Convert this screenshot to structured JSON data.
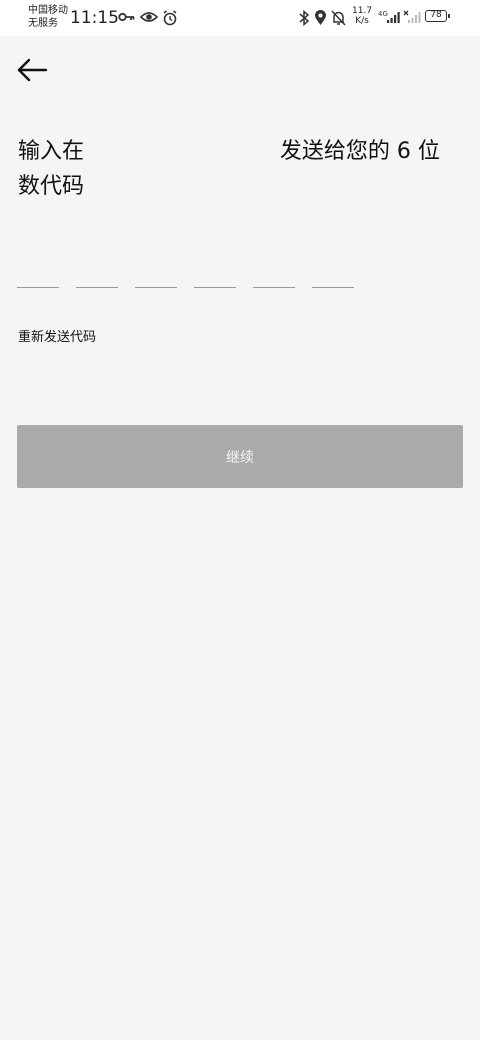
{
  "status_bar": {
    "carrier_line1": "中国移动",
    "carrier_line2": "无服务",
    "time": "11:15",
    "net_speed_value": "11.7",
    "net_speed_unit": "K/s",
    "network": "4G",
    "battery_level": "78",
    "icons": [
      "key-icon",
      "eye-icon",
      "alarm-icon",
      "bluetooth-icon",
      "location-icon",
      "mute-icon",
      "signal-icon",
      "no-signal-icon",
      "battery-icon"
    ]
  },
  "header": {
    "back_icon": "arrow-left-icon"
  },
  "main": {
    "title_prefix": "输入在",
    "masked_phone": "1 3 5 8 · 6 1 2 4 7",
    "title_suffix": "发送给您的 6 位数代码",
    "code_slots": [
      "",
      "",
      "",
      "",
      "",
      ""
    ],
    "resend_label": "重新发送代码",
    "continue_label": "继续"
  },
  "colors": {
    "background": "#f5f5f5",
    "button_disabled": "#aaaaaa",
    "button_text": "#f4f4f4"
  }
}
